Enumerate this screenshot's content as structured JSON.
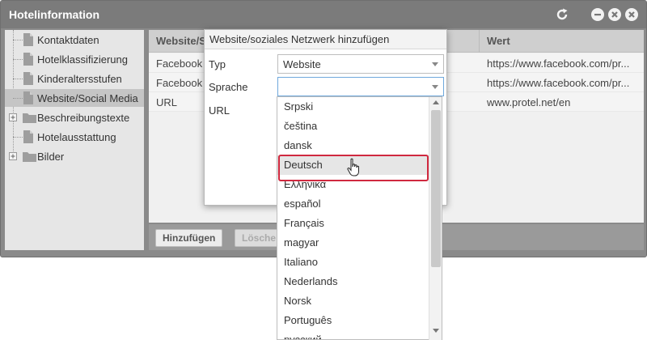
{
  "window": {
    "title": "Hotelinformation"
  },
  "icons": {
    "refresh": "refresh-icon",
    "minimize": "minimize-icon",
    "maximize": "maximize-icon",
    "close": "close-icon"
  },
  "tree": {
    "items": [
      {
        "label": "Kontaktdaten",
        "type": "file",
        "selected": false
      },
      {
        "label": "Hotelklassifizierung",
        "type": "file",
        "selected": false
      },
      {
        "label": "Kinderaltersstufen",
        "type": "file",
        "selected": false
      },
      {
        "label": "Website/Social Media",
        "type": "file",
        "selected": true
      },
      {
        "label": "Beschreibungstexte",
        "type": "folder",
        "selected": false
      },
      {
        "label": "Hotelausstattung",
        "type": "file",
        "selected": false
      },
      {
        "label": "Bilder",
        "type": "folder",
        "selected": false
      }
    ]
  },
  "grid": {
    "columns": [
      "Website/S",
      "Wert"
    ],
    "rows": [
      {
        "type": "Facebook",
        "value": "https://www.facebook.com/pr..."
      },
      {
        "type": "Facebook",
        "value": "https://www.facebook.com/pr..."
      },
      {
        "type": "URL",
        "value": "www.protel.net/en"
      }
    ]
  },
  "footer": {
    "add_label": "Hinzufügen",
    "delete_label": "Lösche"
  },
  "dialog": {
    "title": "Website/soziales Netzwerk hinzufügen",
    "fields": {
      "typ_label": "Typ",
      "typ_value": "Website",
      "sprache_label": "Sprache",
      "sprache_value": "",
      "url_label": "URL"
    }
  },
  "dropdown": {
    "options": [
      "Srpski",
      "čeština",
      "dansk",
      "Deutsch",
      "Ελληνικά",
      "español",
      "Français",
      "magyar",
      "Italiano",
      "Nederlands",
      "Norsk",
      "Português",
      "русский"
    ],
    "hovered": "Deutsch"
  },
  "colors": {
    "titlebar": "#7b7b7b",
    "highlight": "#d0293f",
    "focus": "#6fa8dc"
  }
}
